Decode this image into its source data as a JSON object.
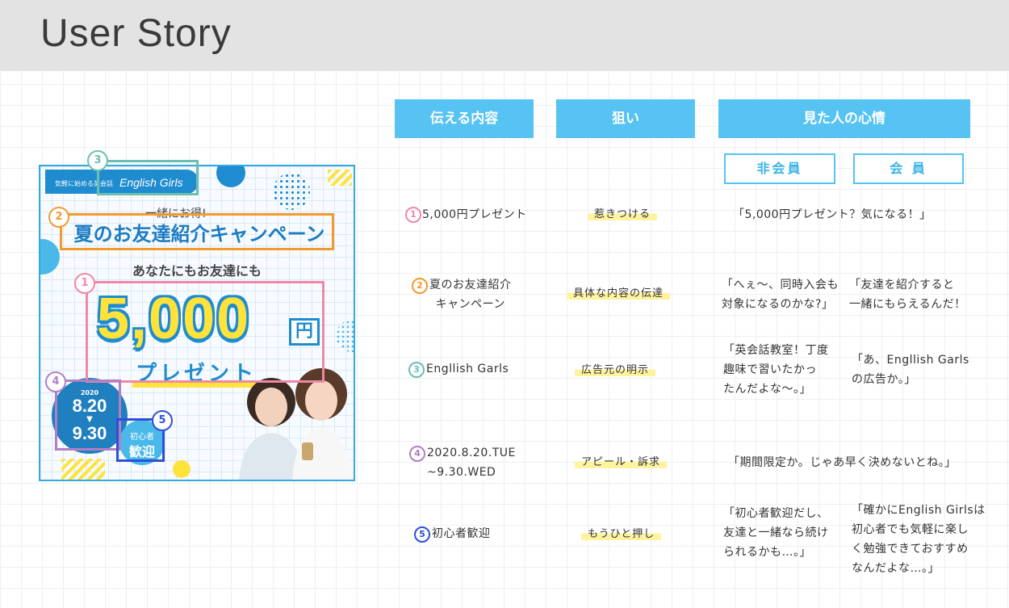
{
  "page": {
    "title": "User Story"
  },
  "banner": {
    "logo_small": "気軽に始める英会話",
    "logo_text": "English Girls",
    "ichido": "一緒にお得!",
    "campaign_title": "夏のお友達紹介キャンペーン",
    "anata": "あなたにもお友達にも",
    "amount": "5,000",
    "yen": "円",
    "present": "プレゼント",
    "date_year": "2020",
    "date_start": "8.20",
    "date_arrow": "▼",
    "date_end": "9.30",
    "beginner_line1": "初心者",
    "beginner_line2": "歓迎",
    "callouts": [
      "1",
      "2",
      "3",
      "4",
      "5"
    ],
    "colors": {
      "pink": "#ef88a6",
      "orange": "#f39a2e",
      "teal": "#6bbfb0",
      "purple": "#b27fc4",
      "blue": "#2e4fd6"
    }
  },
  "table": {
    "headers": {
      "content": "伝える内容",
      "aim": "狙い",
      "feeling": "見た人の心情"
    },
    "sub_headers": {
      "non_member": "非会員",
      "member": "会 員"
    },
    "rows": [
      {
        "num": "1",
        "content": "5,000円プレゼント",
        "aim": "惹きつける",
        "feeling_all": "「5,000円プレゼント？気になる！」"
      },
      {
        "num": "2",
        "content": "夏のお友達紹介\nキャンペーン",
        "aim": "具体な内容の伝達",
        "non_member": "「へぇ〜、同時入会も\n対象になるのかな?」",
        "member": "「友達を紹介すると\n一緒にもらえるんだ！"
      },
      {
        "num": "3",
        "content": "Engllish Garls",
        "aim": "広告元の明示",
        "non_member": "「英会話教室！丁度\n趣味で習いたかっ\nたんだよな〜。」",
        "member": "「あ、Engllish Garls\nの広告か。」"
      },
      {
        "num": "4",
        "content": "2020.8.20.TUE\n~9.30.WED",
        "aim": "アピール・訴求",
        "feeling_all": "「期間限定か。じゃあ早く決めないとね。」"
      },
      {
        "num": "5",
        "content": "初心者歓迎",
        "aim": "もうひと押し",
        "non_member": "「初心者歓迎だし、\n友達と一緒なら続け\nられるかも…。」",
        "member": "「確かにEnglish Girlsは\n初心者でも気軽に楽し\nく勉強できておすすめ\nなんだよな…。」"
      }
    ]
  }
}
